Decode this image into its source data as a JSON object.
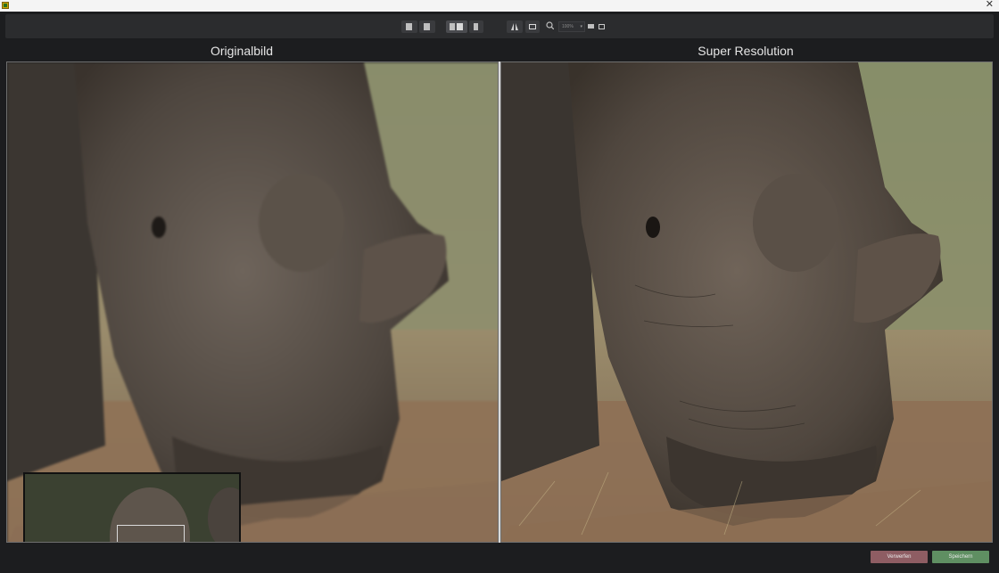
{
  "window": {
    "close_glyph": "✕"
  },
  "toolbar": {
    "buttons": [
      {
        "icon": "single-view-icon"
      },
      {
        "icon": "single-view-alt-icon"
      },
      {
        "icon": "split-view-icon",
        "active": true
      },
      {
        "icon": "split-view-alt-icon"
      },
      {
        "icon": "compare-icon"
      },
      {
        "icon": "fit-view-icon"
      }
    ],
    "zoom_value": "100%",
    "zoom_chevron": "▾",
    "view_buttons": [
      {
        "icon": "window-icon"
      },
      {
        "icon": "fullscreen-icon"
      }
    ]
  },
  "panels": {
    "left_title": "Originalbild",
    "right_title": "Super Resolution"
  },
  "actions": {
    "discard_label": "Verwerfen",
    "save_label": "Speichern"
  },
  "colors": {
    "discard": "#8e5d63",
    "save": "#5f8f62",
    "background": "#1c1d1f"
  }
}
